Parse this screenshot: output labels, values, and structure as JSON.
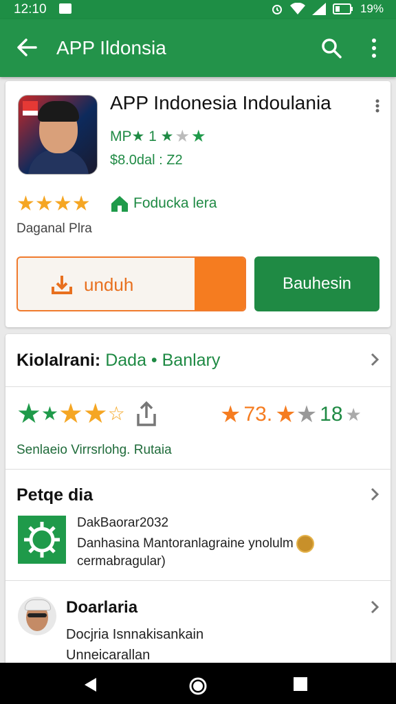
{
  "status_bar": {
    "time": "12:10",
    "battery": "19%",
    "icons": [
      "message-icon",
      "alarm-icon",
      "wifi-icon",
      "signal-icon",
      "battery-icon"
    ]
  },
  "app_bar": {
    "title": "APP Ildonsia"
  },
  "app": {
    "name": "APP Indonesia Indoulania",
    "sub_label": "MP★ 1 ★",
    "price": "$8.0dal : Z2",
    "rating_stars": 4,
    "category": "Foducka lera",
    "developer": "Daganal Plra",
    "download_button": "unduh",
    "second_button": "Bauhesin",
    "download_progress": 0.22
  },
  "ratings_section": {
    "title": "Kiolalrani:",
    "link": "Dada • Banlary",
    "value_a": "73.",
    "value_b": "18",
    "caption": "Senlaeio Virrsrlohg. Rutaia"
  },
  "related_section": {
    "title": "Petqe dia",
    "line1": "DakBaorar2032",
    "line2": "Danhasina Mantoranlagraine ynolulm",
    "line3": "cermabragular)"
  },
  "developer_section": {
    "title": "Doarlaria",
    "line1": "Docjria Isnnakisankain",
    "line2": "Unneicarallan"
  },
  "colors": {
    "brand_green": "#23934a",
    "accent_orange": "#f57c20",
    "star": "#f5a623"
  }
}
